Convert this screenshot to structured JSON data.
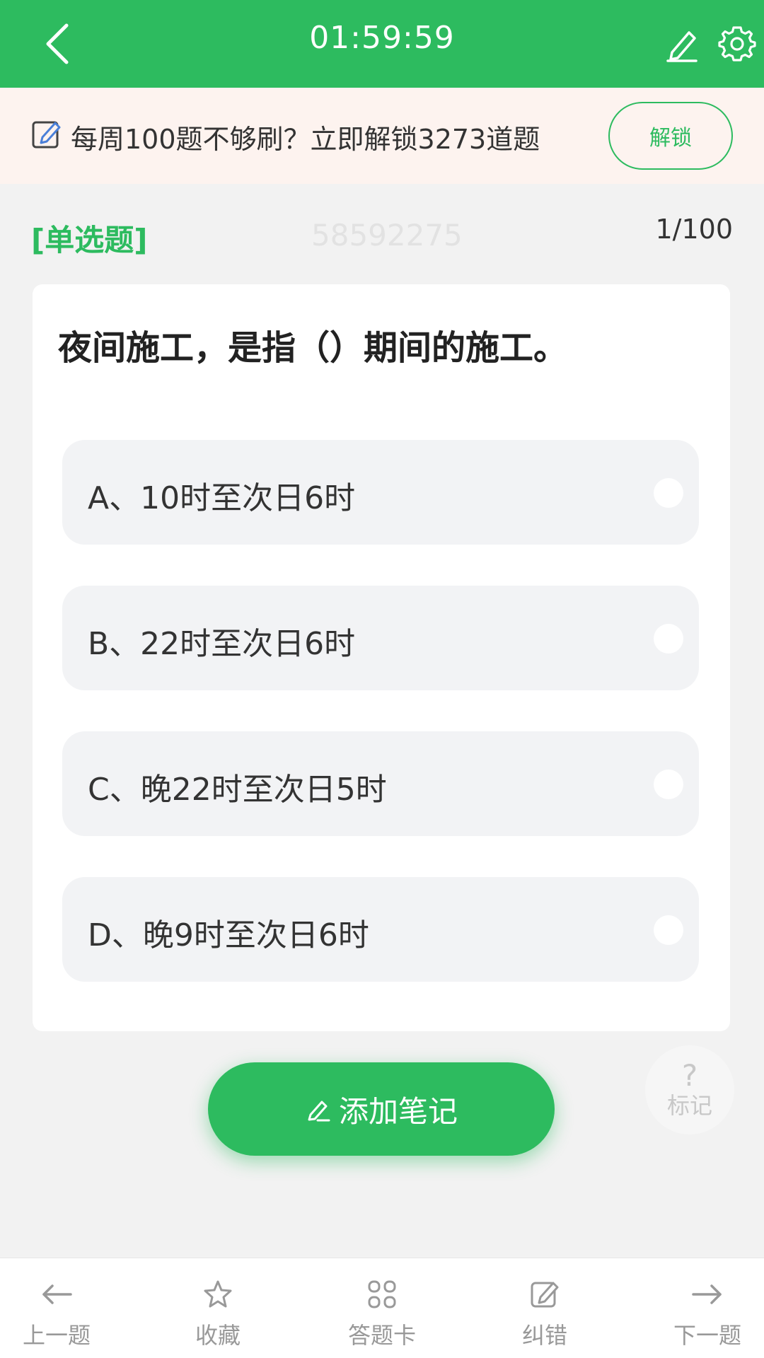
{
  "header": {
    "timer": "01:59:59",
    "color": "#2dbb5f"
  },
  "promo": {
    "text": "每周100题不够刷？立即解锁3273道题",
    "button": "解锁"
  },
  "question": {
    "type": "[单选题]",
    "watermark": "58592275",
    "progress": "1/100",
    "stem": "夜间施工，是指（）期间的施工。",
    "options": [
      {
        "label": "A、10时至次日6时"
      },
      {
        "label": "B、22时至次日6时"
      },
      {
        "label": "C、晚22时至次日5时"
      },
      {
        "label": "D、晚9时至次日6时"
      }
    ]
  },
  "actions": {
    "add_note": "添加笔记",
    "mark_symbol": "?",
    "mark_label": "标记"
  },
  "bottom_nav": {
    "items": [
      {
        "label": "上一题",
        "icon": "arrow-left-icon"
      },
      {
        "label": "收藏",
        "icon": "star-icon"
      },
      {
        "label": "答题卡",
        "icon": "grid-icon"
      },
      {
        "label": "纠错",
        "icon": "edit-icon"
      },
      {
        "label": "下一题",
        "icon": "arrow-right-icon"
      }
    ]
  }
}
